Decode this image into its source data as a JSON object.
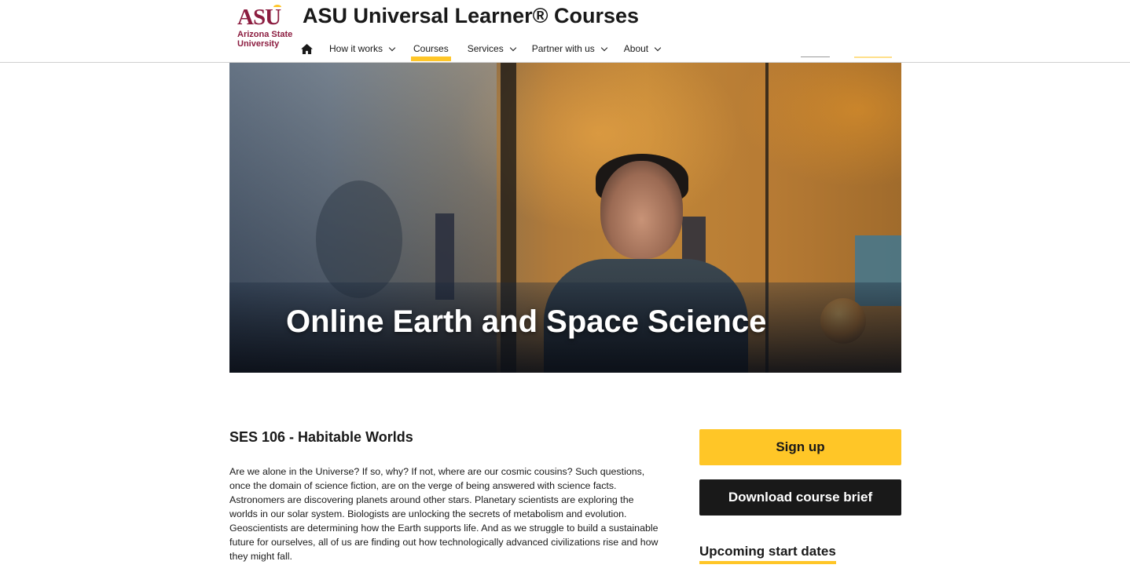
{
  "header": {
    "logo": {
      "mark": "ASU",
      "line1": "Arizona State",
      "line2": "University"
    },
    "site_title": "ASU Universal Learner® Courses",
    "nav": {
      "home_icon": "home-icon",
      "items": [
        {
          "label": "How it works",
          "dropdown": true
        },
        {
          "label": "Courses",
          "dropdown": false,
          "active": true
        },
        {
          "label": "Services",
          "dropdown": true
        },
        {
          "label": "Partner with us",
          "dropdown": true
        },
        {
          "label": "About",
          "dropdown": true
        }
      ]
    }
  },
  "hero": {
    "title": "Online Earth and Space Science"
  },
  "course": {
    "code_title": "SES 106 - Habitable Worlds",
    "description": "Are we alone in the Universe? If so, why? If not, where are our cosmic cousins? Such questions, once the domain of science fiction, are on the verge of being answered with science facts. Astronomers are discovering planets around other stars. Planetary scientists are exploring the worlds in our solar system. Biologists are unlocking the secrets of metabolism and evolution. Geoscientists are determining how the Earth supports life. And as we struggle to build a sustainable future for ourselves, all of us are finding out how technologically advanced civilizations rise and how they might fall."
  },
  "sidebar": {
    "signup_label": "Sign up",
    "download_label": "Download course brief",
    "dates_heading": "Upcoming start dates"
  },
  "colors": {
    "maroon": "#8c1d40",
    "gold": "#ffc627",
    "dark": "#191919"
  }
}
